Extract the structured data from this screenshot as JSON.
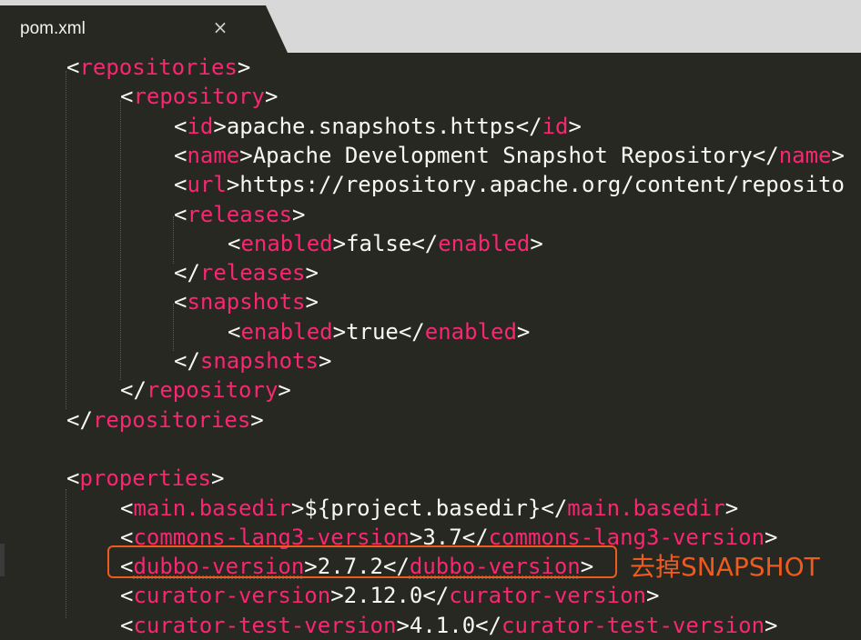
{
  "tab": {
    "title": "pom.xml",
    "close": "×"
  },
  "annotation": "去掉SNAPSHOT",
  "lines": [
    {
      "indent": 1,
      "open": "repositories"
    },
    {
      "indent": 2,
      "open": "repository"
    },
    {
      "indent": 3,
      "open": "id",
      "text": "apache.snapshots.https",
      "close": "id"
    },
    {
      "indent": 3,
      "open": "name",
      "text": "Apache Development Snapshot Repository",
      "close": "name"
    },
    {
      "indent": 3,
      "open": "url",
      "text": "https://repository.apache.org/content/reposito"
    },
    {
      "indent": 3,
      "open": "releases"
    },
    {
      "indent": 4,
      "open": "enabled",
      "text": "false",
      "close": "enabled"
    },
    {
      "indent": 3,
      "close": "releases"
    },
    {
      "indent": 3,
      "open": "snapshots"
    },
    {
      "indent": 4,
      "open": "enabled",
      "text": "true",
      "close": "enabled"
    },
    {
      "indent": 3,
      "close": "snapshots"
    },
    {
      "indent": 2,
      "close": "repository"
    },
    {
      "indent": 1,
      "close": "repositories"
    },
    {
      "indent": 0
    },
    {
      "indent": 1,
      "open": "properties"
    },
    {
      "indent": 2,
      "open": "main.basedir",
      "text": "${project.basedir}",
      "close": "main.basedir"
    },
    {
      "indent": 2,
      "open": "commons-lang3-version",
      "text": "3.7",
      "close": "commons-lang3-version"
    },
    {
      "indent": 2,
      "open": "dubbo-version",
      "text": "2.7.2",
      "close": "dubbo-version",
      "underline": true
    },
    {
      "indent": 2,
      "open": "curator-version",
      "text": "2.12.0",
      "close": "curator-version"
    },
    {
      "indent": 2,
      "open": "curator-test-version",
      "text": "4.1.0",
      "close": "curator-test-version"
    }
  ]
}
